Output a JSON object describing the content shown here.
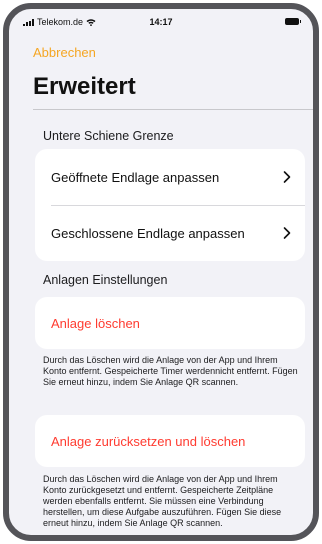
{
  "status_bar": {
    "carrier": "Telekom.de",
    "time": "14:17"
  },
  "nav": {
    "cancel_label": "Abbrechen"
  },
  "page": {
    "title": "Erweitert"
  },
  "sections": [
    {
      "header": "Untere Schiene Grenze",
      "rows": [
        {
          "label": "Geöffnete Endlage anpassen"
        },
        {
          "label": "Geschlossene Endlage anpassen"
        }
      ]
    },
    {
      "header": "Anlagen Einstellungen",
      "delete_label": "Anlage löschen",
      "delete_note": "Durch das Löschen wird die Anlage von der App und Ihrem Konto entfernt. Gespeicherte Timer werdennicht entfernt. Fügen Sie erneut hinzu, indem Sie Anlage QR scannen.",
      "reset_label": "Anlage zurücksetzen und löschen",
      "reset_note": "Durch das Löschen wird die Anlage von der App und Ihrem Konto zurückgesetzt und entfernt. Gespeicherte Zeitpläne werden ebenfalls entfernt. Sie müssen eine Verbindung herstellen, um diese Aufgabe auszuführen. Fügen Sie diese erneut hinzu, indem Sie Anlage QR scannen."
    }
  ],
  "colors": {
    "accent": "#f5a623",
    "destructive": "#ff3b30",
    "background": "#f2f2f7",
    "frame": "#545459"
  },
  "icons": {
    "signal": "signal-icon",
    "wifi": "wifi-icon",
    "battery": "battery-icon",
    "chevron": "chevron-right-icon"
  }
}
